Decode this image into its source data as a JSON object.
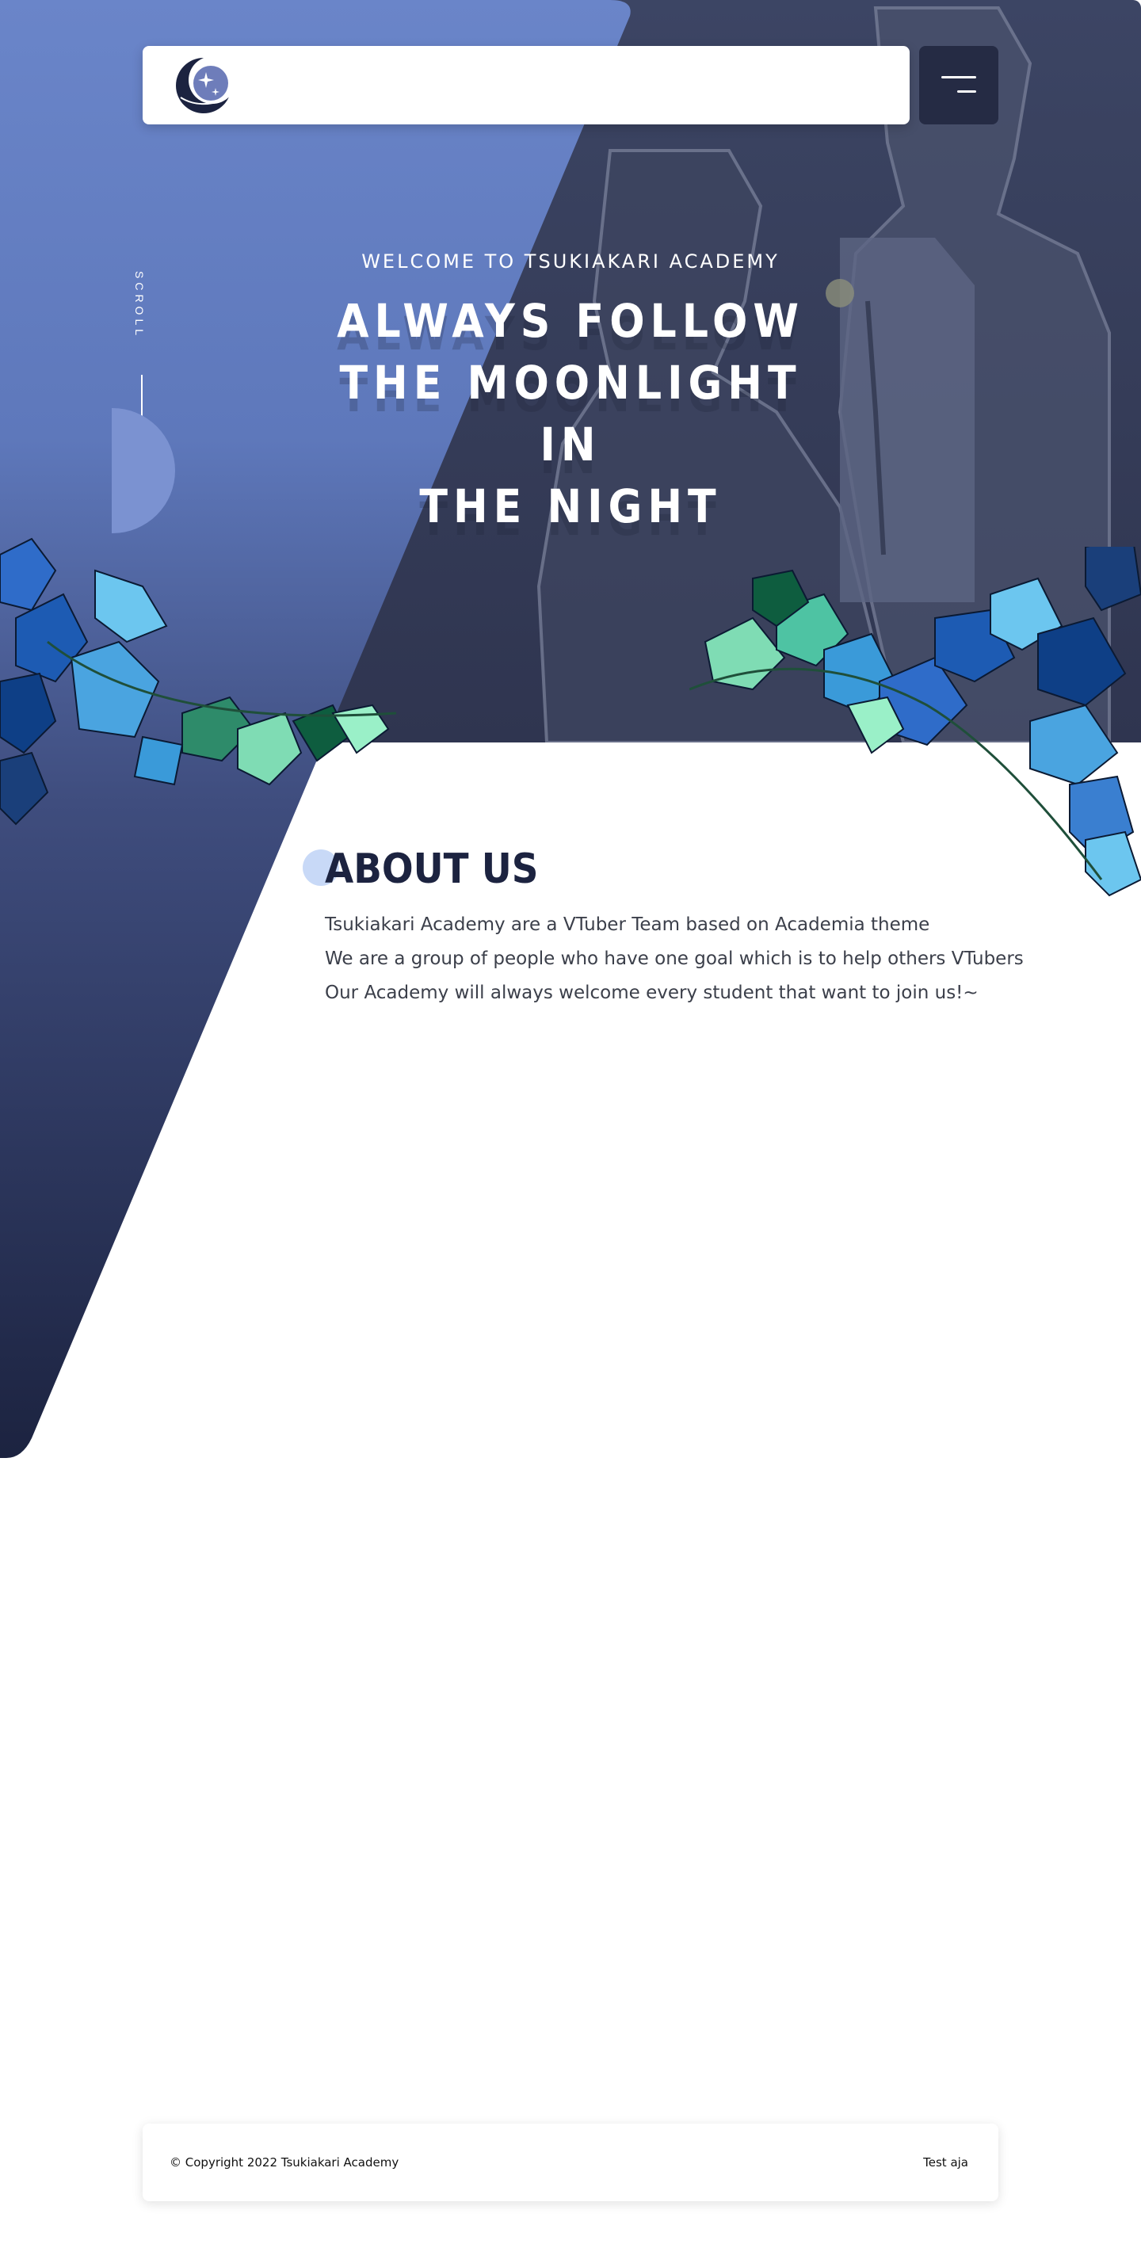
{
  "hero": {
    "kicker": "WELCOME TO TSUKIAKARI ACADEMY",
    "title_line_1": "ALWAYS FOLLOW",
    "title_line_2": "THE MOONLIGHT IN",
    "title_line_3": "THE NIGHT",
    "scroll_label": "SCROLL"
  },
  "nav": {
    "logo_icon": "crescent-moon-logo-icon",
    "menu_icon": "hamburger-menu-icon"
  },
  "about": {
    "title": "ABOUT US",
    "lines": [
      "Tsukiakari Academy are a VTuber Team based on Academia theme",
      "We are a group of people who have one goal which is to help others VTubers",
      "Our Academy will always welcome every student that want to join us!~"
    ]
  },
  "footer": {
    "copyright": "© Copyright 2022 Tsukiakari Academy",
    "link": "Test aja"
  },
  "colors": {
    "hero_bg": "#3c4564",
    "accent_blue": "#6a85c9",
    "dark_navy": "#1c2340",
    "menu_bg": "#252b44"
  }
}
